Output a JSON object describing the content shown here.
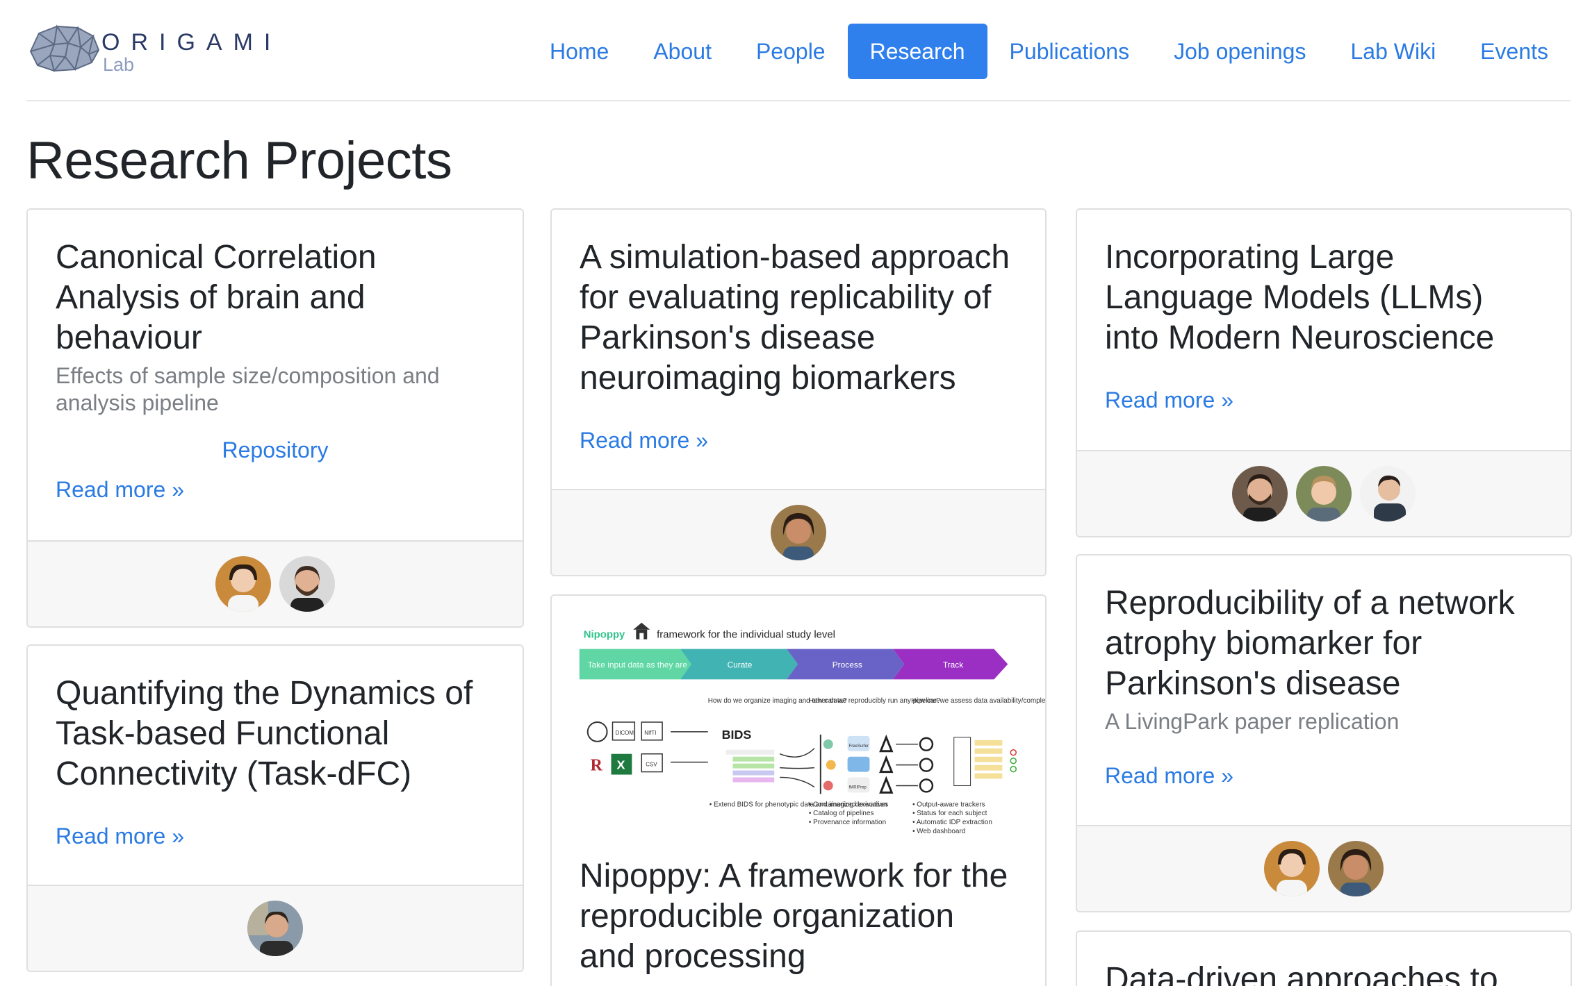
{
  "header": {
    "logo_word": "ORIGAMI",
    "logo_sub": "Lab",
    "nav": [
      {
        "label": "Home",
        "active": false
      },
      {
        "label": "About",
        "active": false
      },
      {
        "label": "People",
        "active": false
      },
      {
        "label": "Research",
        "active": true
      },
      {
        "label": "Publications",
        "active": false
      },
      {
        "label": "Job openings",
        "active": false
      },
      {
        "label": "Lab Wiki",
        "active": false
      },
      {
        "label": "Events",
        "active": false
      }
    ]
  },
  "page": {
    "title": "Research Projects"
  },
  "cards": {
    "cca": {
      "title": "Canonical Correlation Analysis of brain and behaviour",
      "subtitle": "Effects of sample size/composition and analysis pipeline",
      "link": "Repository",
      "read_more": "Read more »"
    },
    "taskdfc": {
      "title": "Quantifying the Dynamics of Task-based Functional Connectivity (Task-dFC)",
      "read_more": "Read more »"
    },
    "simulation": {
      "title": "A simulation-based approach for evaluating replicability of Parkinson's disease neuroimaging biomarkers",
      "read_more": "Read more »"
    },
    "nipoppy": {
      "title": "Nipoppy: A framework for the reproducible organization and processing",
      "figure": {
        "brand": "Nipoppy",
        "caption": "framework for the individual study level",
        "stages": [
          "Take input data as they are",
          "Curate",
          "Process",
          "Track"
        ],
        "q1": "How do we organize imaging and other data?",
        "q2": "How can we reproducibly run any pipeline?",
        "q3": "How can we assess data availability/completion?",
        "bids": "BIDS",
        "b1": "• Extend BIDS for phenotypic data and imaging derivatives",
        "b2": "• Containerized execution\n• Catalog of pipelines\n• Provenance information",
        "b3": "• Output-aware trackers\n• Status for each subject\n• Automatic IDP extraction\n• Web dashboard",
        "files": [
          "DICOM",
          "NIfTI",
          "CSV"
        ],
        "pipelines": [
          "FreeSurfer",
          "fMRIPrep"
        ],
        "colors": {
          "take": "#5fd6a4",
          "curate": "#41b3b3",
          "process": "#6a63c7",
          "track": "#9b2fc4"
        }
      }
    },
    "llm": {
      "title": "Incorporating Large Language Models (LLMs) into Modern Neuroscience",
      "read_more": "Read more »"
    },
    "atrophy": {
      "title": "Reproducibility of a network atrophy biomarker for Parkinson's disease",
      "subtitle": "A LivingPark paper replication",
      "read_more": "Read more »"
    },
    "datadriven": {
      "title": "Data-driven approaches to"
    }
  },
  "colors": {
    "link": "#2a7ae4",
    "active_nav": "#2f80ed",
    "footer_bg": "#f7f7f7"
  }
}
